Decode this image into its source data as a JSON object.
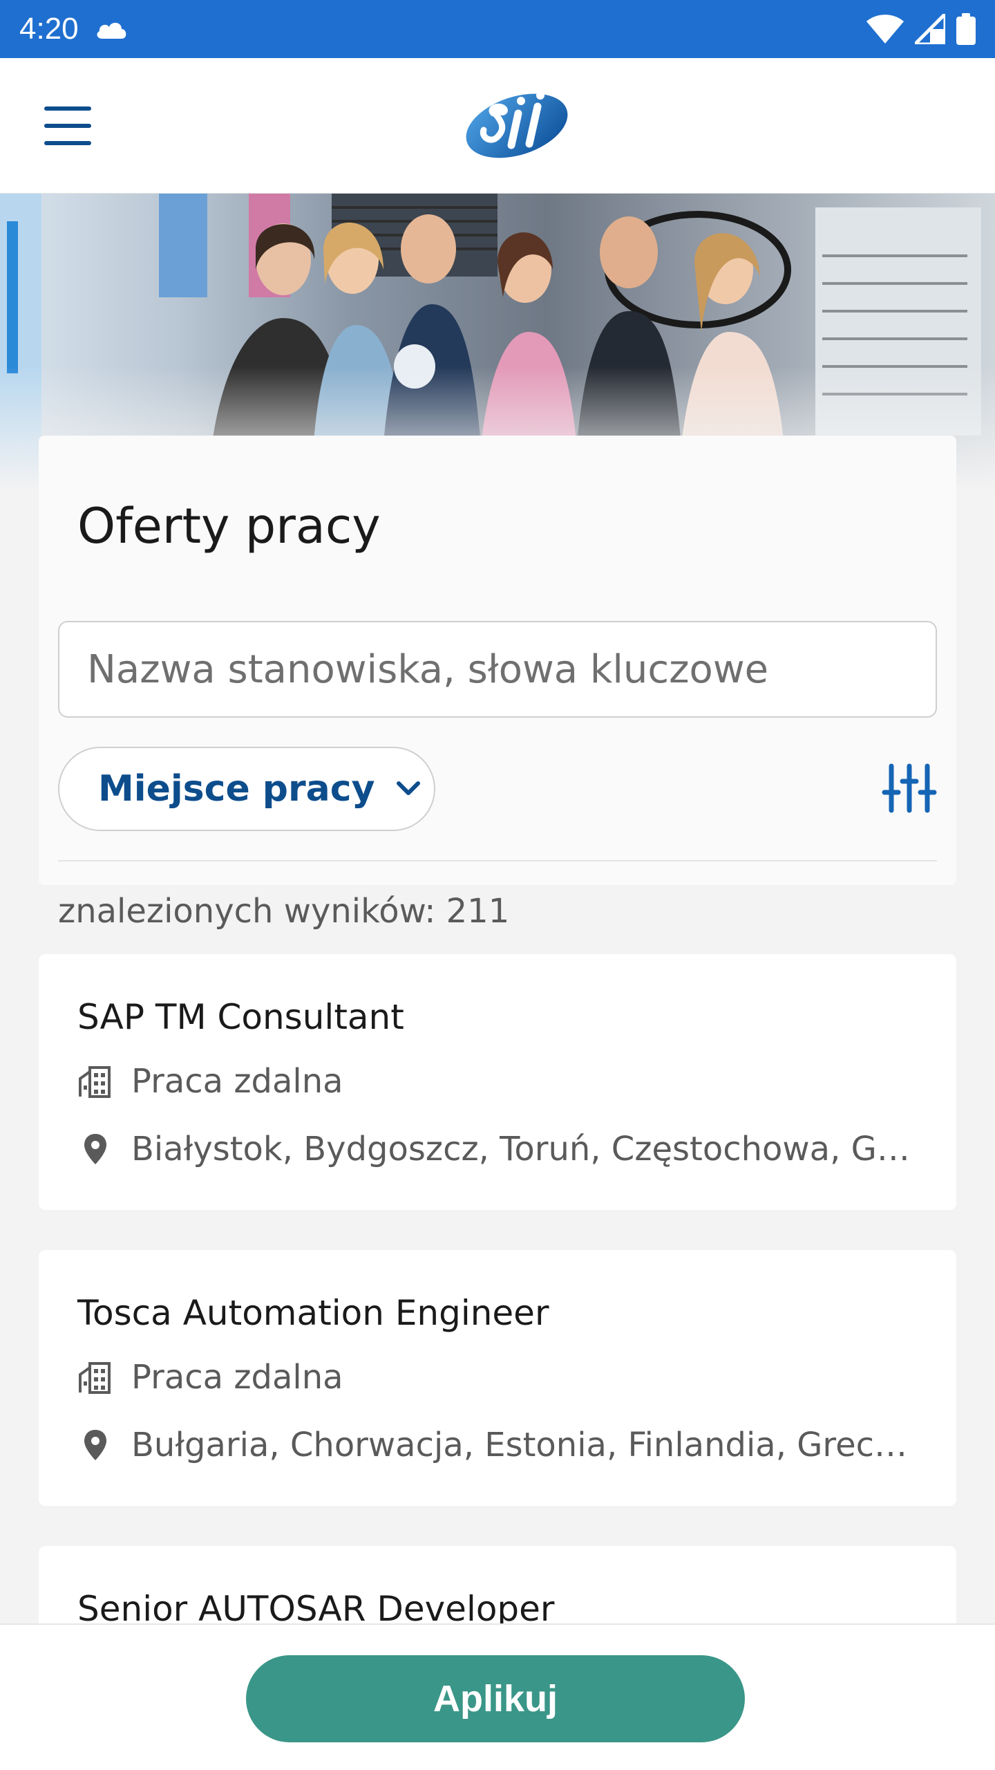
{
  "status_bar": {
    "time": "4:20"
  },
  "app_bar": {
    "logo_text": "Sii"
  },
  "search": {
    "title": "Oferty pracy",
    "placeholder": "Nazwa stanowiska, słowa kluczowe",
    "location_label": "Miejsce pracy",
    "results_text": "znalezionych wyników: 211"
  },
  "jobs": [
    {
      "title": "SAP TM Consultant",
      "work_mode": "Praca zdalna",
      "locations": "Białystok, Bydgoszcz, Toruń, Częstochowa, Gliwice,..."
    },
    {
      "title": "Tosca Automation Engineer",
      "work_mode": "Praca zdalna",
      "locations": "Bułgaria, Chorwacja, Estonia, Finlandia, Grecja, Litw..."
    },
    {
      "title": "Senior AUTOSAR Developer"
    }
  ],
  "apply": {
    "label": "Aplikuj"
  },
  "colors": {
    "status_bar": "#1f6fd0",
    "brand_blue": "#0d4d8c",
    "apply_green": "#3a9688"
  },
  "icons": {
    "menu": "hamburger-icon",
    "filter": "sliders-icon",
    "location_chevron": "chevron-down-icon",
    "work_mode": "building-icon",
    "location": "location-pin-icon"
  }
}
